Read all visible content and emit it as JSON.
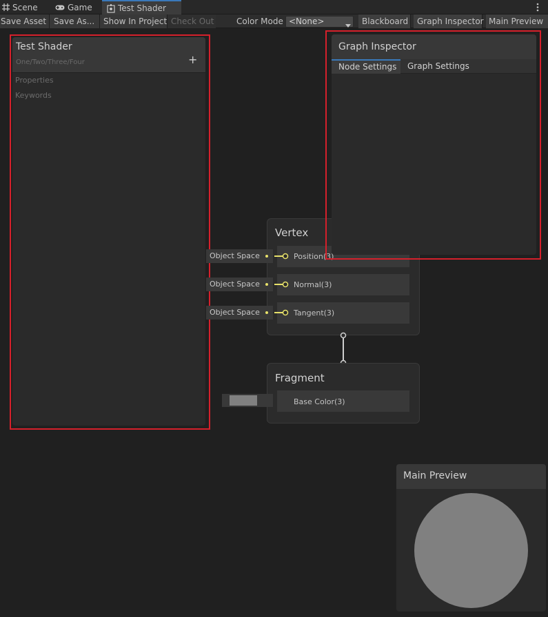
{
  "tabs": [
    {
      "label": "Scene",
      "icon": "grid-icon"
    },
    {
      "label": "Game",
      "icon": "gamepad-icon"
    },
    {
      "label": "Test Shader",
      "icon": "shader-icon"
    }
  ],
  "toolbar": {
    "save_asset": "Save Asset",
    "save_as": "Save As...",
    "show_in_project": "Show In Project",
    "check_out": "Check Out",
    "color_mode_label": "Color Mode",
    "color_mode_value": "<None>",
    "blackboard": "Blackboard",
    "graph_inspector": "Graph Inspector",
    "main_preview": "Main Preview"
  },
  "blackboard": {
    "title": "Test Shader",
    "path": "One/Two/Three/Four",
    "sections": [
      "Properties",
      "Keywords"
    ],
    "add_glyph": "+"
  },
  "inspector": {
    "title": "Graph Inspector",
    "tabs": [
      "Node Settings",
      "Graph Settings"
    ],
    "active_tab": "Node Settings"
  },
  "vertex": {
    "title": "Vertex",
    "ports": [
      {
        "label": "Position(3)",
        "connection": "Object Space"
      },
      {
        "label": "Normal(3)",
        "connection": "Object Space"
      },
      {
        "label": "Tangent(3)",
        "connection": "Object Space"
      }
    ]
  },
  "fragment": {
    "title": "Fragment",
    "ports": [
      {
        "label": "Base Color(3)",
        "connection_color": "#808080"
      }
    ]
  },
  "main_preview": {
    "title": "Main Preview",
    "sphere_color": "#808080"
  },
  "colors": {
    "background": "#202020",
    "accent": "#3a79bb",
    "highlight_box": "#d6202b",
    "port_color": "#e8e26a"
  }
}
